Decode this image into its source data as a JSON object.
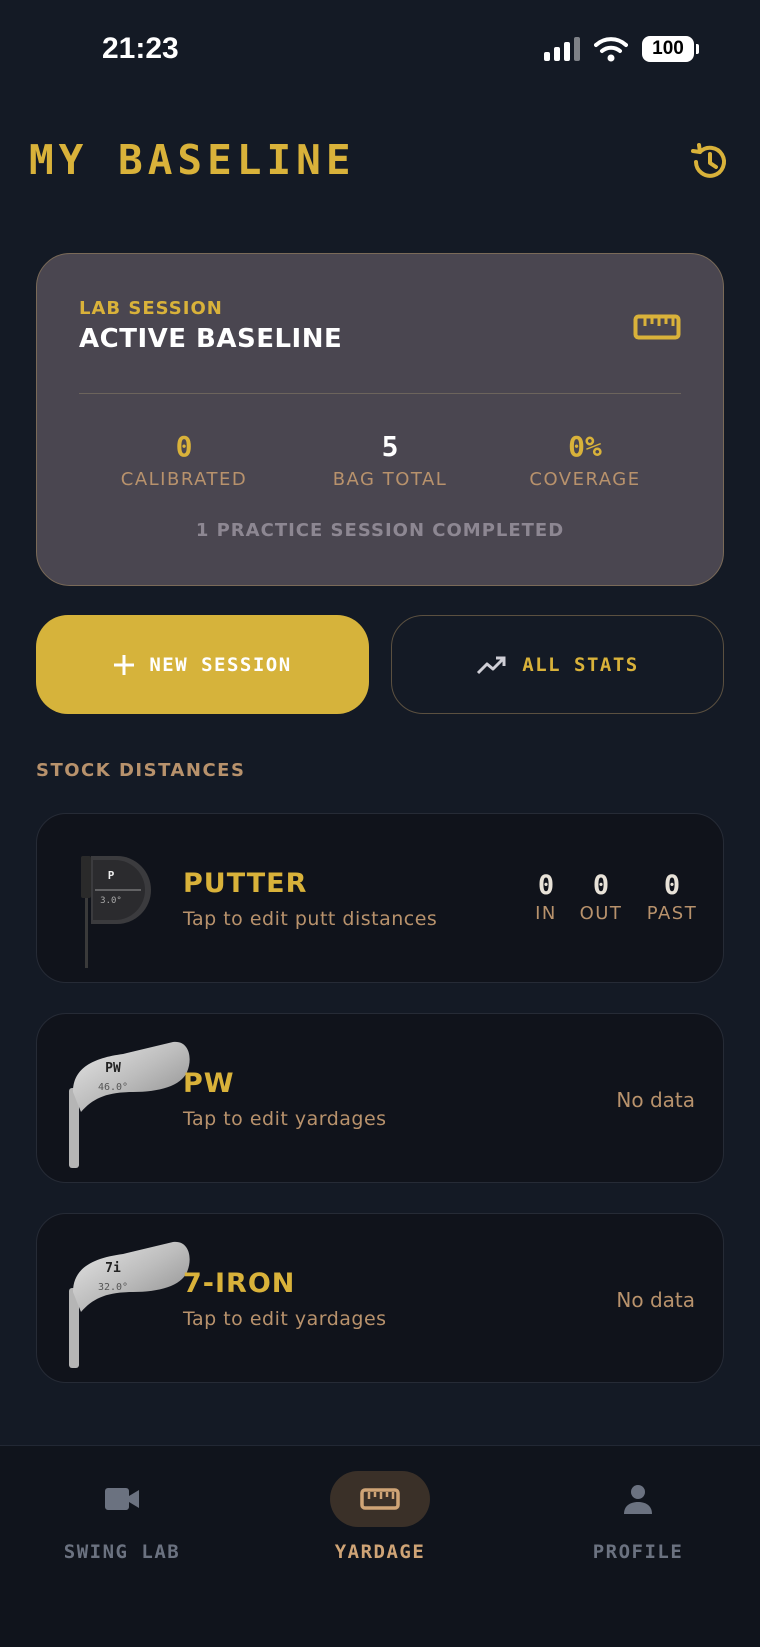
{
  "status_bar": {
    "time": "21:23",
    "battery": "100"
  },
  "header": {
    "title": "MY BASELINE"
  },
  "baseline_card": {
    "kicker": "LAB SESSION",
    "title": "ACTIVE BASELINE",
    "stats": [
      {
        "value": "0",
        "label": "CALIBRATED"
      },
      {
        "value": "5",
        "label": "BAG TOTAL"
      },
      {
        "value": "0%",
        "label": "COVERAGE"
      }
    ],
    "footer": "1 PRACTICE SESSION COMPLETED"
  },
  "actions": {
    "new_session": "NEW SESSION",
    "all_stats": "ALL STATS"
  },
  "stock": {
    "label": "STOCK DISTANCES",
    "clubs": [
      {
        "name": "PUTTER",
        "subtitle": "Tap to edit putt distances",
        "head_label": "P",
        "loft": "3.0°",
        "putts": [
          {
            "value": "0",
            "label": "IN"
          },
          {
            "value": "0",
            "label": "OUT"
          },
          {
            "value": "0",
            "label": "PAST"
          }
        ]
      },
      {
        "name": "PW",
        "subtitle": "Tap to edit yardages",
        "head_label": "PW",
        "loft": "46.0°",
        "status": "No data"
      },
      {
        "name": "7-IRON",
        "subtitle": "Tap to edit yardages",
        "head_label": "7i",
        "loft": "32.0°",
        "status": "No data"
      }
    ]
  },
  "nav": {
    "items": [
      {
        "label": "SWING LAB",
        "icon": "video-camera-icon"
      },
      {
        "label": "YARDAGE",
        "icon": "ruler-icon",
        "active": true
      },
      {
        "label": "PROFILE",
        "icon": "person-icon"
      }
    ]
  },
  "colors": {
    "accent": "#d9b23a",
    "muted": "#b8926c",
    "background": "#141a25",
    "card": "#4a4650"
  }
}
